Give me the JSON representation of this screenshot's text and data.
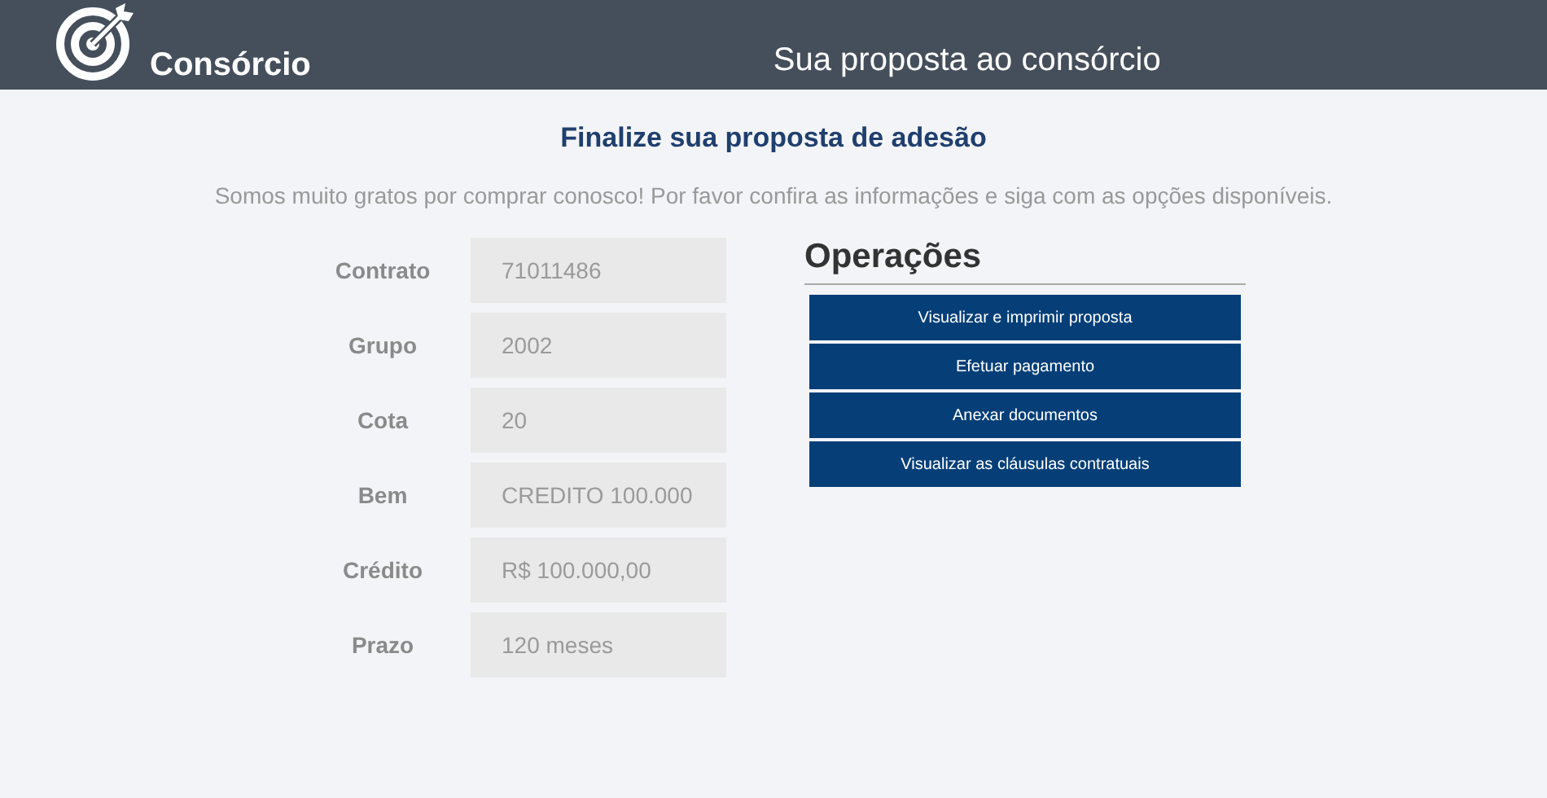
{
  "header": {
    "brand": "Consórcio",
    "title": "Sua proposta ao consórcio"
  },
  "heading": "Finalize sua proposta de adesão",
  "intro": "Somos muito gratos por comprar conosco! Por favor confira as informações e siga com as opções disponíveis.",
  "fields": [
    {
      "label": "Contrato",
      "value": "71011486"
    },
    {
      "label": "Grupo",
      "value": "2002"
    },
    {
      "label": "Cota",
      "value": "20"
    },
    {
      "label": "Bem",
      "value": "CREDITO 100.000"
    },
    {
      "label": "Crédito",
      "value": "R$ 100.000,00"
    },
    {
      "label": "Prazo",
      "value": "120 meses"
    }
  ],
  "operations": {
    "title": "Operações",
    "buttons": [
      "Visualizar e imprimir proposta",
      "Efetuar pagamento",
      "Anexar documentos",
      "Visualizar as cláusulas contratuais"
    ]
  }
}
